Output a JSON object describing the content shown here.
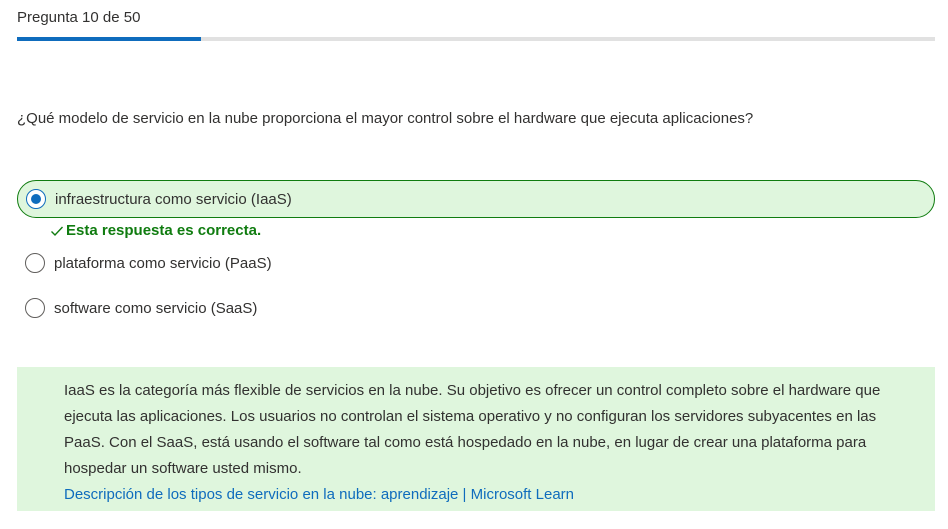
{
  "progress": {
    "label": "Pregunta 10 de 50",
    "current": 10,
    "total": 50,
    "fraction": 0.2,
    "fill_color": "#0f6cbd"
  },
  "question": {
    "text": "¿Qué modelo de servicio en la nube proporciona el mayor control sobre el hardware que ejecuta aplicaciones?"
  },
  "options": [
    {
      "label": "infraestructura como servicio (IaaS)",
      "selected": true,
      "correct": true
    },
    {
      "label": "plataforma como servicio (PaaS)",
      "selected": false
    },
    {
      "label": "software como servicio (SaaS)",
      "selected": false
    }
  ],
  "feedback": {
    "text": "Esta respuesta es correcta.",
    "icon": "checkmark-icon",
    "color": "#107c10"
  },
  "explanation": {
    "text": "IaaS es la categoría más flexible de servicios en la nube. Su objetivo es ofrecer un control completo sobre el hardware que ejecuta las aplicaciones. Los usuarios no controlan el sistema operativo y no configuran los servidores subyacentes en las PaaS. Con el SaaS, está usando el software tal como está hospedado en la nube, en lugar de crear una plataforma para hospedar un software usted mismo.",
    "link_text": "Descripción de los tipos de servicio en la nube: aprendizaje | Microsoft Learn",
    "background": "#dff6dd"
  }
}
